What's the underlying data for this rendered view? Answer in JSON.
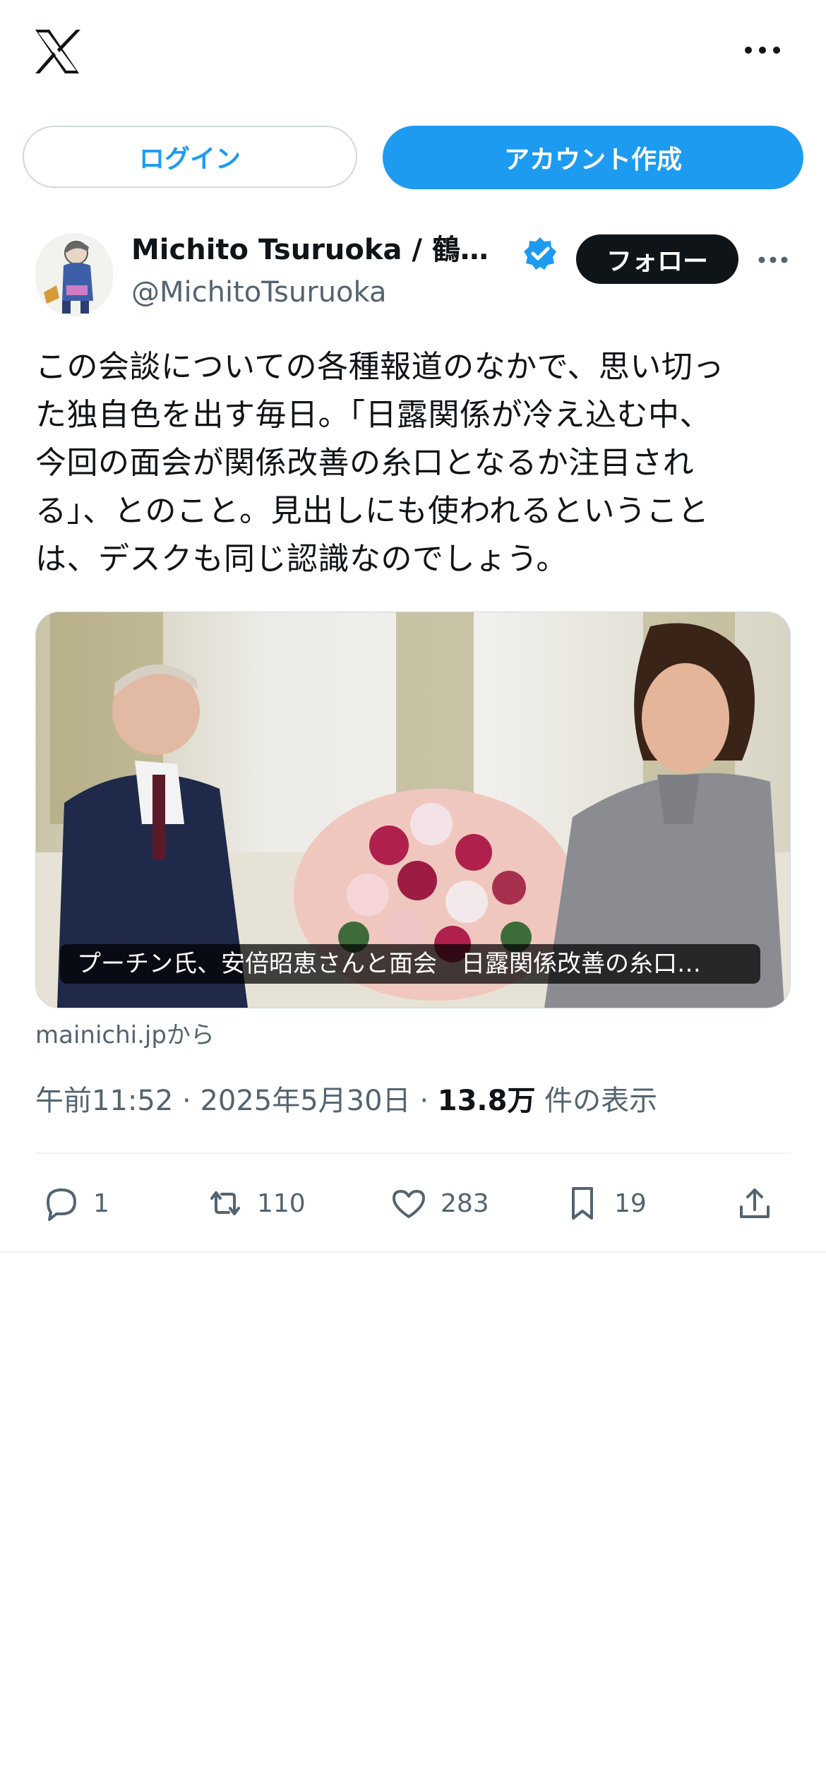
{
  "header": {
    "logo_icon": "x-logo-icon",
    "more_icon": "more-horizontal-icon"
  },
  "auth": {
    "login_label": "ログイン",
    "signup_label": "アカウント作成"
  },
  "author": {
    "display_name": "Michito Tsuruoka / 鶴…",
    "handle": "@MichitoTsuruoka",
    "verified_icon": "verified-badge-icon",
    "follow_label": "フォロー",
    "more_icon": "more-horizontal-icon"
  },
  "tweet": {
    "text_lines": [
      "この会談についての各種報道のなかで、思い切っ",
      "た独自色を出す毎日。「日露関係が冷え込む中、",
      "今回の面会が関係改善の糸口となるか注目され",
      "る」、とのこと。見出しにも使われるということ",
      "は、デスクも同じ認識なのでしょう。"
    ],
    "card_caption": "プーチン氏、安倍昭恵さんと面会　日露関係改善の糸口…",
    "card_source": "mainichi.jpから",
    "time": "午前11:52",
    "date": "2025年5月30日",
    "views": "13.8万",
    "views_label": "件の表示"
  },
  "actions": {
    "reply_count": "1",
    "retweet_count": "110",
    "like_count": "283",
    "bookmark_count": "19"
  },
  "colors": {
    "accent": "#1d9bf0",
    "text": "#0f1419",
    "muted": "#536471"
  }
}
